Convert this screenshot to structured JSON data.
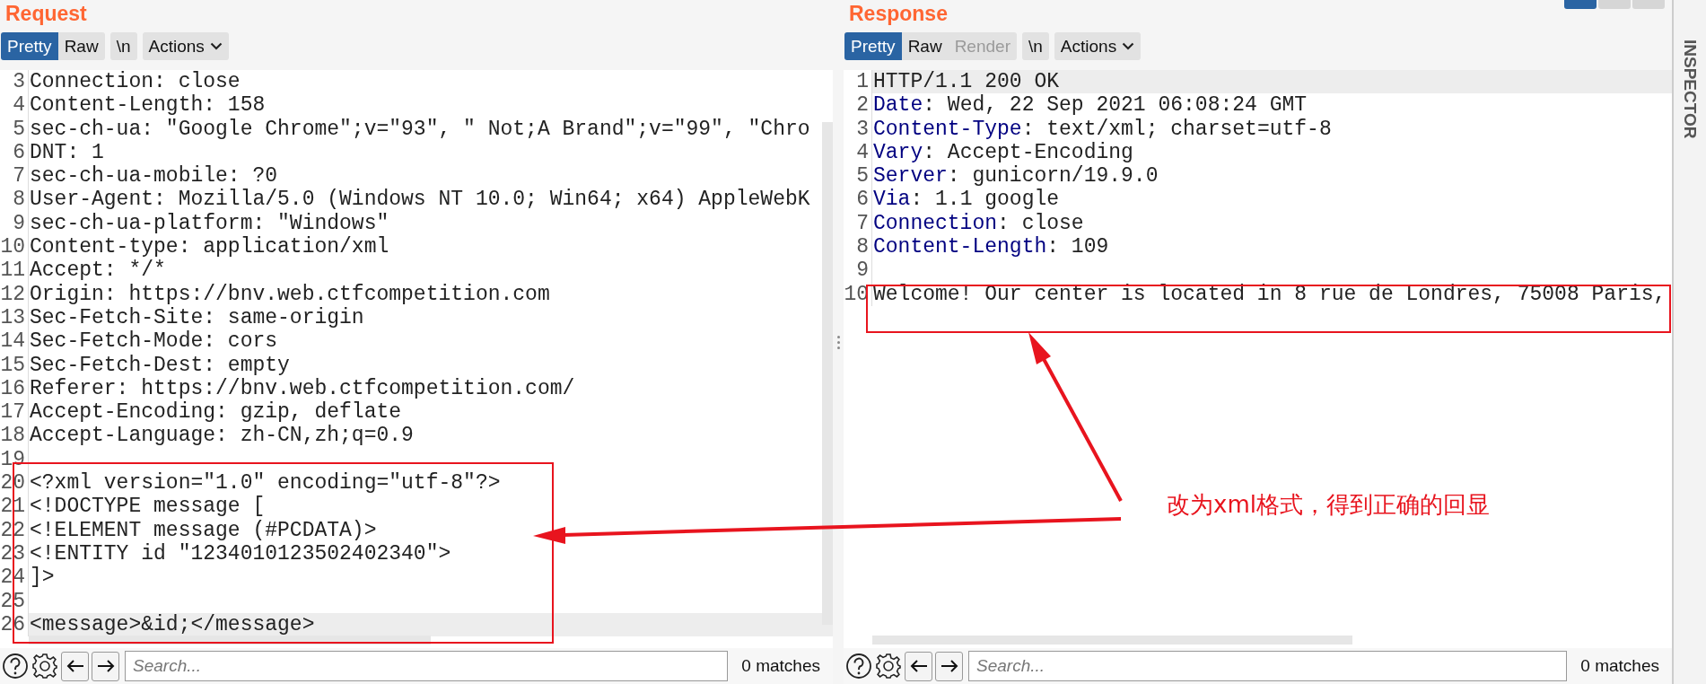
{
  "request": {
    "title": "Request",
    "tabs": [
      {
        "label": "Pretty",
        "selected": true,
        "disabled": false
      },
      {
        "label": "Raw",
        "selected": false,
        "disabled": false
      }
    ],
    "newline_button": "\\n",
    "actions_button": "Actions",
    "lines": [
      {
        "number": "3",
        "text": "Connection: close",
        "current": false
      },
      {
        "number": "4",
        "text": "Content-Length: 158",
        "current": false
      },
      {
        "number": "5",
        "text": "sec-ch-ua: \"Google Chrome\";v=\"93\", \" Not;A Brand\";v=\"99\", \"Chro",
        "current": false
      },
      {
        "number": "6",
        "text": "DNT: 1",
        "current": false
      },
      {
        "number": "7",
        "text": "sec-ch-ua-mobile: ?0",
        "current": false
      },
      {
        "number": "8",
        "text": "User-Agent: Mozilla/5.0 (Windows NT 10.0; Win64; x64) AppleWebK",
        "current": false
      },
      {
        "number": "9",
        "text": "sec-ch-ua-platform: \"Windows\"",
        "current": false
      },
      {
        "number": "10",
        "text": "Content-type: application/xml",
        "current": false
      },
      {
        "number": "11",
        "text": "Accept: */*",
        "current": false
      },
      {
        "number": "12",
        "text": "Origin: https://bnv.web.ctfcompetition.com",
        "current": false
      },
      {
        "number": "13",
        "text": "Sec-Fetch-Site: same-origin",
        "current": false
      },
      {
        "number": "14",
        "text": "Sec-Fetch-Mode: cors",
        "current": false
      },
      {
        "number": "15",
        "text": "Sec-Fetch-Dest: empty",
        "current": false
      },
      {
        "number": "16",
        "text": "Referer: https://bnv.web.ctfcompetition.com/",
        "current": false
      },
      {
        "number": "17",
        "text": "Accept-Encoding: gzip, deflate",
        "current": false
      },
      {
        "number": "18",
        "text": "Accept-Language: zh-CN,zh;q=0.9",
        "current": false
      },
      {
        "number": "19",
        "current": false
      },
      {
        "number": "20",
        "text": "<?xml version=\"1.0\" encoding=\"utf-8\"?>",
        "current": false
      },
      {
        "number": "21",
        "text": "<!DOCTYPE message [",
        "current": false
      },
      {
        "number": "22",
        "text": "<!ELEMENT message (#PCDATA)>",
        "current": false
      },
      {
        "number": "23",
        "text": "<!ENTITY id \"1234010123502402340\">",
        "current": false
      },
      {
        "number": "24",
        "text": "]>",
        "current": false
      },
      {
        "number": "25",
        "current": false
      },
      {
        "number": "26",
        "text": "<message>&id;</message>",
        "current": true
      }
    ],
    "search": {
      "placeholder": "Search...",
      "matches": "0 matches"
    }
  },
  "response": {
    "title": "Response",
    "layout_buttons": [
      {
        "selected": true
      },
      {
        "selected": false
      },
      {
        "selected": false
      }
    ],
    "tabs": [
      {
        "label": "Pretty",
        "selected": true,
        "disabled": false
      },
      {
        "label": "Raw",
        "selected": false,
        "disabled": false
      },
      {
        "label": "Render",
        "selected": false,
        "disabled": true
      }
    ],
    "newline_button": "\\n",
    "actions_button": "Actions",
    "lines": [
      {
        "number": "1",
        "text": "HTTP/1.1 200 OK",
        "current": true
      },
      {
        "number": "2",
        "key": "Date",
        "text": ": Wed, 22 Sep 2021 06:08:24 GMT",
        "current": false
      },
      {
        "number": "3",
        "key": "Content-Type",
        "text": ": text/xml; charset=utf-8",
        "current": false
      },
      {
        "number": "4",
        "key": "Vary",
        "text": ": Accept-Encoding",
        "current": false
      },
      {
        "number": "5",
        "key": "Server",
        "text": ": gunicorn/19.9.0",
        "current": false
      },
      {
        "number": "6",
        "key": "Via",
        "text": ": 1.1 google",
        "current": false
      },
      {
        "number": "7",
        "key": "Connection",
        "text": ": close",
        "current": false
      },
      {
        "number": "8",
        "key": "Content-Length",
        "text": ": 109",
        "current": false
      },
      {
        "number": "9",
        "current": false
      },
      {
        "number": "10",
        "text": "Welcome! Our center is located in 8 rue de Londres, 75008 Paris,",
        "current": false
      }
    ],
    "search": {
      "placeholder": "Search...",
      "matches": "0 matches"
    }
  },
  "inspector": {
    "label": "INSPECTOR"
  },
  "annotation": {
    "text": "改为xml格式，得到正确的回显"
  }
}
